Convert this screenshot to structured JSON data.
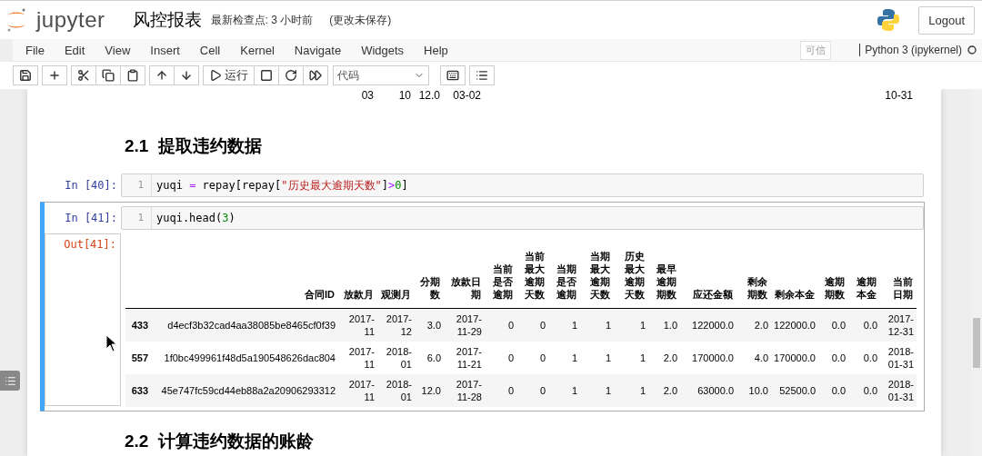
{
  "header": {
    "logo": "jupyter",
    "notebook_title": "风控报表",
    "checkpoint": "最新检查点: 3 小时前",
    "save_status": "(更改未保存)",
    "logout": "Logout"
  },
  "menu": [
    "File",
    "Edit",
    "View",
    "Insert",
    "Cell",
    "Kernel",
    "Navigate",
    "Widgets",
    "Help"
  ],
  "trusted": "可信",
  "kernel": "Python 3 (ipykernel)",
  "toolbar": {
    "run_label": "运行",
    "cell_type": "代码"
  },
  "cells": [
    {
      "kind": "table_tail",
      "cells": [
        "03",
        "10",
        "12.0",
        "03-02",
        "10-31"
      ]
    },
    {
      "kind": "heading",
      "text": "2.1  提取违约数据"
    },
    {
      "kind": "code",
      "selected": false,
      "prompt": "In [40]:",
      "line": "1",
      "tokens": [
        {
          "text": "yuqi ",
          "kind": "plain"
        },
        {
          "text": "=",
          "kind": "op"
        },
        {
          "text": " repay[repay[",
          "kind": "plain"
        },
        {
          "text": "\"历史最大逾期天数\"",
          "kind": "string"
        },
        {
          "text": "]",
          "kind": "plain"
        },
        {
          "text": ">",
          "kind": "op"
        },
        {
          "text": "0",
          "kind": "number"
        },
        {
          "text": "]",
          "kind": "plain"
        }
      ]
    },
    {
      "kind": "code",
      "selected": true,
      "prompt": "In [41]:",
      "line": "1",
      "tokens": [
        {
          "text": "yuqi.head(",
          "kind": "plain"
        },
        {
          "text": "3",
          "kind": "number"
        },
        {
          "text": ")",
          "kind": "plain"
        }
      ],
      "output": {
        "prompt": "Out[41]:",
        "columns": [
          "合同ID",
          "放款月",
          "观测月",
          "分期数",
          "放款日期",
          "当前是否逾期",
          "当前最大逾期天数",
          "当期是否逾期",
          "当期最大逾期天数",
          "历史最大逾期天数",
          "最早逾期期数",
          "应还金额",
          "剩余期数",
          "剩余本金",
          "逾期期数",
          "逾期本金",
          "当前日期"
        ],
        "rows": [
          {
            "index": "433",
            "cells": [
              "d4ecf3b32cad4aa38085be8465cf0f39",
              "2017-11",
              "2017-12",
              "3.0",
              "2017-11-29",
              "0",
              "0",
              "1",
              "1",
              "1",
              "1.0",
              "122000.0",
              "2.0",
              "122000.0",
              "0.0",
              "0.0",
              "2017-12-31"
            ]
          },
          {
            "index": "557",
            "cells": [
              "1f0bc499961f48d5a190548626dac804",
              "2017-11",
              "2018-01",
              "6.0",
              "2017-11-21",
              "0",
              "0",
              "1",
              "1",
              "1",
              "2.0",
              "170000.0",
              "4.0",
              "170000.0",
              "0.0",
              "0.0",
              "2018-01-31"
            ]
          },
          {
            "index": "633",
            "cells": [
              "45e747fc59cd44eb88a2a20906293312",
              "2017-11",
              "2018-01",
              "12.0",
              "2017-11-28",
              "0",
              "0",
              "1",
              "1",
              "1",
              "2.0",
              "63000.0",
              "10.0",
              "52500.0",
              "0.0",
              "0.0",
              "2018-01-31"
            ]
          }
        ]
      }
    },
    {
      "kind": "heading",
      "text": "2.2  计算违约数据的账龄"
    }
  ]
}
